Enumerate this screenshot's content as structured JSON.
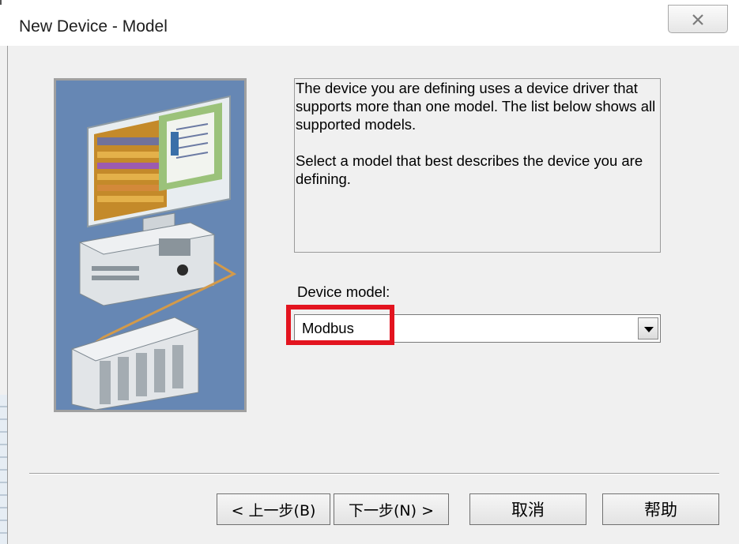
{
  "window": {
    "title": "New Device - Model",
    "close_glyph": "⌦"
  },
  "description": {
    "paragraph1": "The device you are defining uses a device driver that supports more than one model.  The list below shows all supported models.",
    "paragraph2": "Select  a model that best describes the device you are defining."
  },
  "device_model": {
    "label": "Device model:",
    "selected_value": "Modbus"
  },
  "buttons": {
    "back": "< 上一步(B)",
    "next": "下一步(N) >",
    "cancel": "取消",
    "help": "帮助"
  },
  "colors": {
    "highlight": "#e3141f",
    "illustration_bg": "#6687b4"
  },
  "icons": {
    "close": "close-icon",
    "dropdown": "chevron-down-icon",
    "illustration": "computer-plc-network-illustration"
  }
}
